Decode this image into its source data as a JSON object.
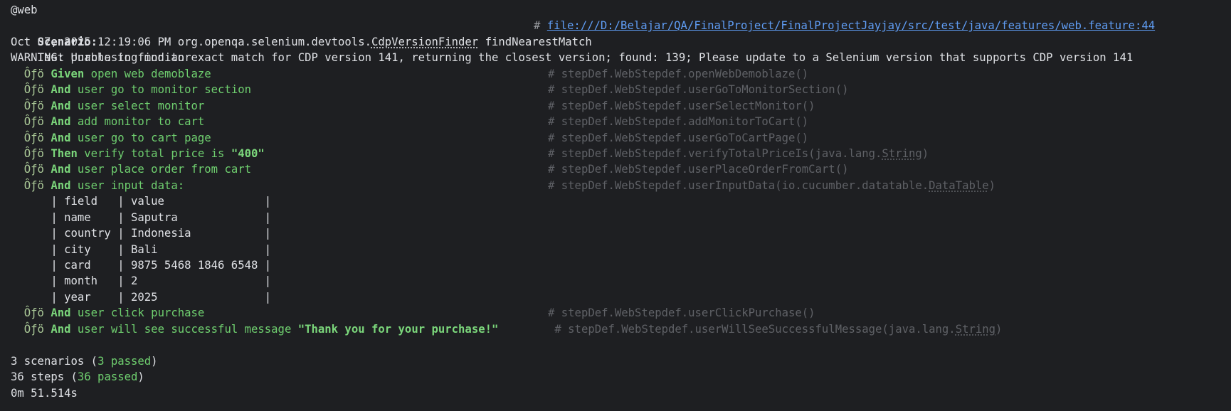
{
  "tag": "@web",
  "scenario": {
    "keyword": "Scenario:",
    "name": "Test purchasing monitor",
    "comment_hash": "#",
    "location_link": "file:///D:/Belajar/QA/FinalProject/FinalProjectJayjay/src/test/java/features/web.feature:44"
  },
  "log": {
    "date_prefix": "Oct 07, 2025 12:19:06 PM org.openqa.selenium.devtools.",
    "class_name": "CdpVersionFinder",
    "method": " findNearestMatch",
    "warning": "WARNING: Unable to find an exact match for CDP version 141, returning the closest version; found: 139; Please update to a Selenium version that supports CDP version 141"
  },
  "step_marker": "Ôƒö",
  "steps": [
    {
      "keyword": "Given",
      "text": " open web demoblaze",
      "comment": "# stepDef.WebStepdef.openWebDemoblaze()"
    },
    {
      "keyword": "And",
      "text": " user go to monitor section",
      "comment": "# stepDef.WebStepdef.userGoToMonitorSection()"
    },
    {
      "keyword": "And",
      "text": " user select monitor",
      "comment": "# stepDef.WebStepdef.userSelectMonitor()"
    },
    {
      "keyword": "And",
      "text": " add monitor to cart",
      "comment": "# stepDef.WebStepdef.addMonitorToCart()"
    },
    {
      "keyword": "And",
      "text": " user go to cart page",
      "comment": "# stepDef.WebStepdef.userGoToCartPage()"
    },
    {
      "keyword": "Then",
      "text": " verify total price is ",
      "quoted": "\"400\"",
      "comment_pre": "# stepDef.WebStepdef.verifyTotalPriceIs(java.lang.",
      "comment_type": "String",
      "comment_post": ")"
    },
    {
      "keyword": "And",
      "text": " user place order from cart",
      "comment": "# stepDef.WebStepdef.userPlaceOrderFromCart()"
    },
    {
      "keyword": "And",
      "text": " user input data:",
      "comment_pre": "# stepDef.WebStepdef.userInputData(io.cucumber.datatable.",
      "comment_type": "DataTable",
      "comment_post": ")"
    },
    {
      "keyword": "And",
      "text": " user click purchase",
      "comment": "# stepDef.WebStepdef.userClickPurchase()"
    },
    {
      "keyword": "And",
      "text": " user will see successful message ",
      "quoted": "\"Thank you for your purchase!\"",
      "comment_pre": "# stepDef.WebStepdef.userWillSeeSuccessfulMessage(java.lang.",
      "comment_type": "String",
      "comment_post": ")"
    }
  ],
  "data_table": [
    "      | field   | value               |",
    "      | name    | Saputra             |",
    "      | country | Indonesia           |",
    "      | city    | Bali                |",
    "      | card    | 9875 5468 1846 6548 |",
    "      | month   | 2                   |",
    "      | year    | 2025                |"
  ],
  "summary": {
    "scenarios_pre": "3 scenarios (",
    "scenarios_passed": "3 passed",
    "scenarios_post": ")",
    "steps_pre": "36 steps (",
    "steps_passed": "36 passed",
    "steps_post": ")",
    "duration": "0m 51.514s"
  },
  "colors": {
    "background": "#1e1f22",
    "text": "#dfe1e5",
    "keyword_green": "#7bd67b",
    "comment_gray": "#5f6166",
    "link_blue": "#5f9cf3"
  }
}
